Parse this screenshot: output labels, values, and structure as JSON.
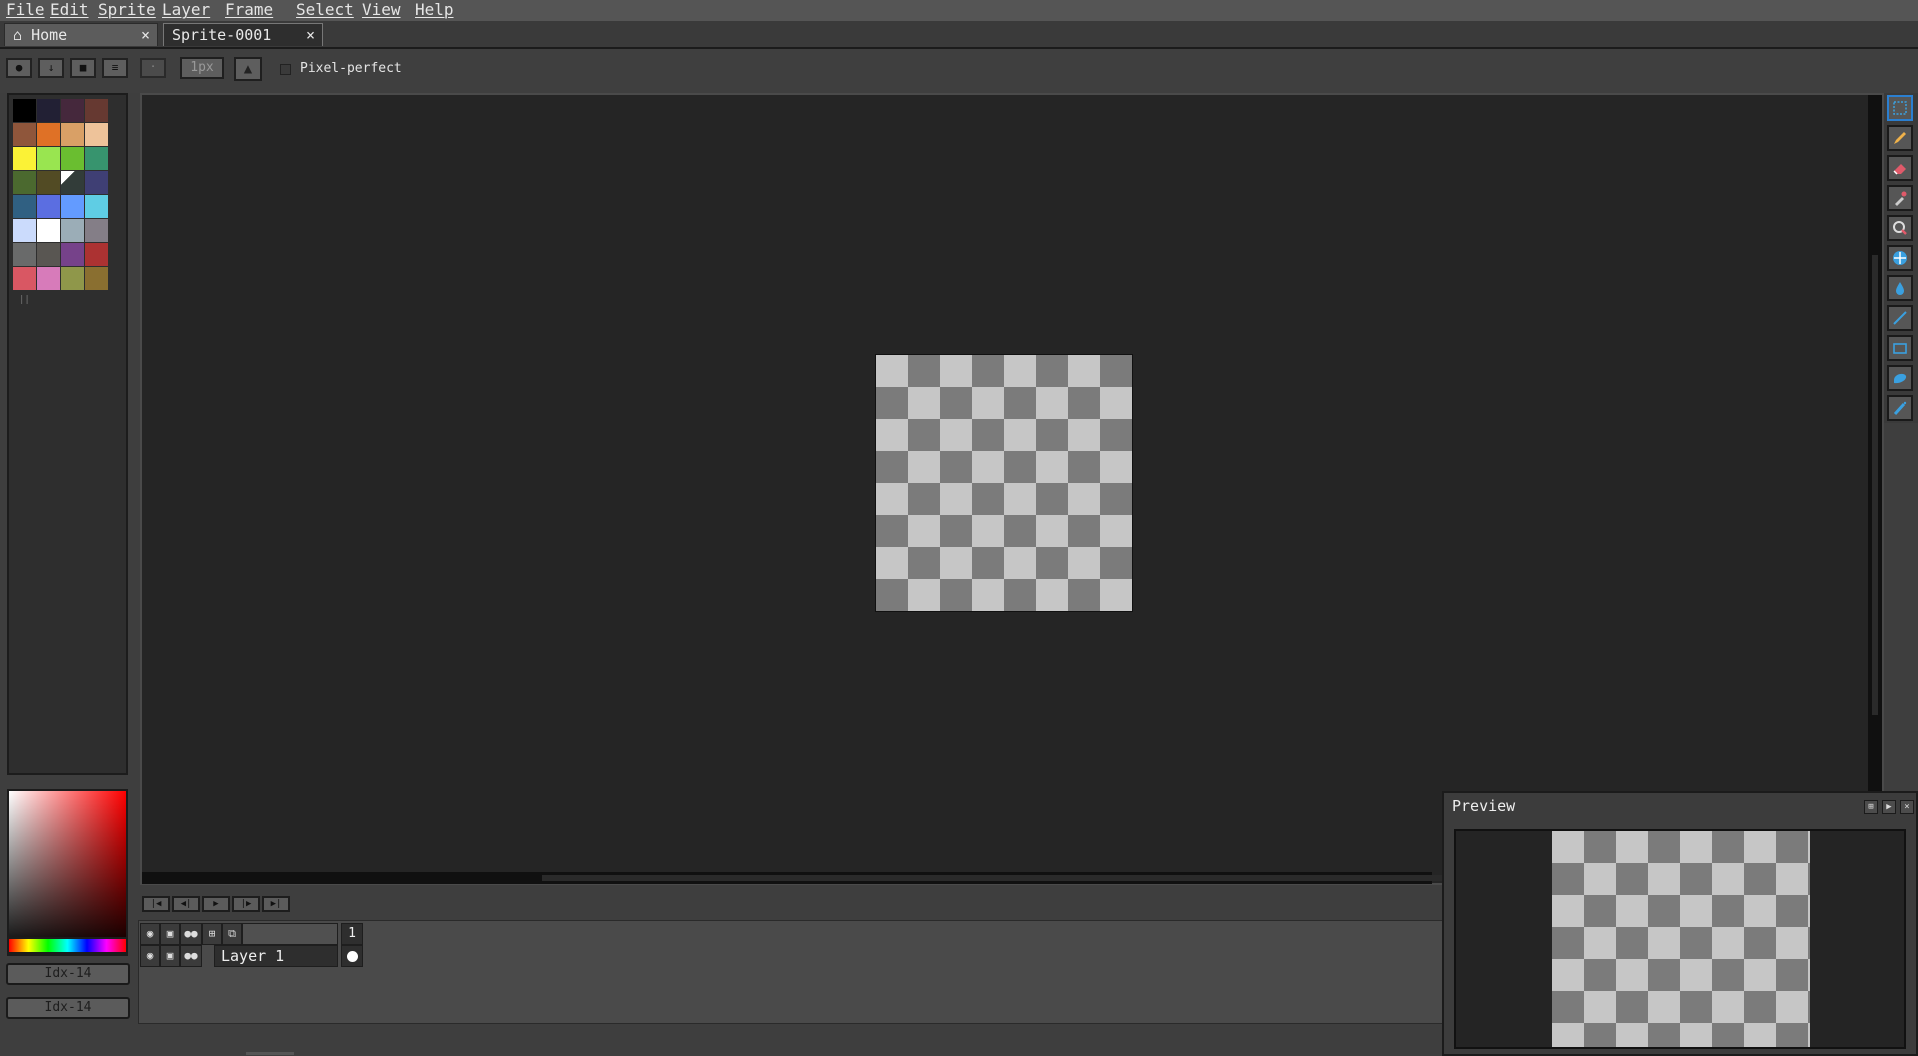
{
  "menu": [
    "File",
    "Edit",
    "Sprite",
    "Layer",
    "Frame",
    "Select",
    "View",
    "Help"
  ],
  "tabs": [
    {
      "label": "Home",
      "close": "×"
    },
    {
      "label": "Sprite-0001",
      "close": "×"
    }
  ],
  "context_bar": {
    "brush_size": "1px",
    "pixel_perfect_label": "Pixel-perfect"
  },
  "palette": {
    "colors": [
      "#000000",
      "#222034",
      "#45283c",
      "#663931",
      "#8f563b",
      "#df7126",
      "#d9a066",
      "#eec39a",
      "#fbf236",
      "#99e550",
      "#6abe30",
      "#37946e",
      "#4b692f",
      "#524b24",
      "#323c39",
      "#3f3f74",
      "#306082",
      "#5b6ee1",
      "#639bff",
      "#5fcde4",
      "#cbdbfc",
      "#ffffff",
      "#9badb7",
      "#847e87",
      "#696a6a",
      "#595652",
      "#76428a",
      "#ac3232",
      "#d95763",
      "#d77bba",
      "#8f974a",
      "#8a6f30"
    ]
  },
  "color_indicators": {
    "foreground": "Idx-14",
    "background": "Idx-14"
  },
  "tools": [
    {
      "name": "marquee-icon",
      "color": "#3aa0e0"
    },
    {
      "name": "pencil-icon",
      "color": "#f0b24a"
    },
    {
      "name": "eraser-icon",
      "color": "#e05a6a"
    },
    {
      "name": "eyedropper-icon",
      "color": "#cccccc"
    },
    {
      "name": "zoom-icon",
      "color": "#dddddd"
    },
    {
      "name": "move-icon",
      "color": "#3aa0e0"
    },
    {
      "name": "paint-bucket-icon",
      "color": "#3aa0e0"
    },
    {
      "name": "line-icon",
      "color": "#3aa0e0"
    },
    {
      "name": "rectangle-icon",
      "color": "#3aa0e0"
    },
    {
      "name": "lasso-icon",
      "color": "#3aa0e0"
    },
    {
      "name": "spray-icon",
      "color": "#3aa0e0"
    }
  ],
  "timeline": {
    "frame_number": "1",
    "layers": [
      {
        "name": "Layer 1"
      }
    ]
  },
  "preview": {
    "title": "Preview"
  }
}
